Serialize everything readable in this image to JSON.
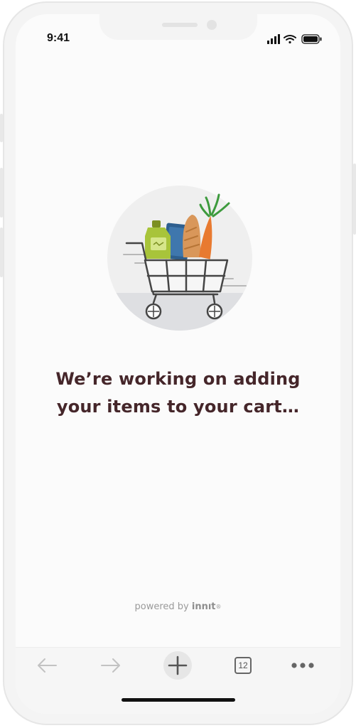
{
  "status_bar": {
    "time": "9:41"
  },
  "message": {
    "line1": "We’re working on adding",
    "line2": "your items to your cart…"
  },
  "footer": {
    "powered_by": "powered by",
    "brand": "innıt",
    "brand_mark": "®"
  },
  "toolbar": {
    "back_icon": "arrow-left-icon",
    "forward_icon": "arrow-right-icon",
    "new_tab_icon": "plus-icon",
    "tabs_count": "12",
    "more_icon": "ellipsis-icon"
  },
  "colors": {
    "headline": "#45262a",
    "illustration_bg": "#efefef",
    "carrot": "#e87a30",
    "bottle": "#a8c43a"
  }
}
